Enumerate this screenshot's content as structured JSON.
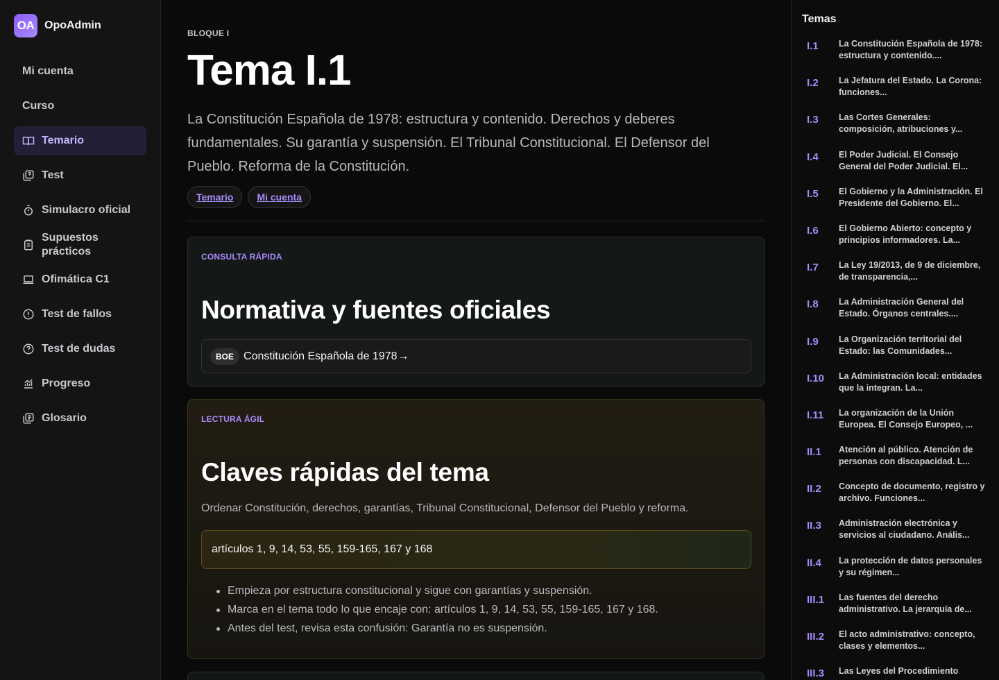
{
  "brand": {
    "logo": "OA",
    "name": "OpoAdmin"
  },
  "sidebar": {
    "items": [
      {
        "label": "Mi cuenta",
        "icon": "none",
        "active": false
      },
      {
        "label": "Curso",
        "icon": "none",
        "active": false
      },
      {
        "label": "Temario",
        "icon": "book-open-icon",
        "active": true
      },
      {
        "label": "Test",
        "icon": "quiz-icon",
        "active": false
      },
      {
        "label": "Simulacro oficial",
        "icon": "stopwatch-icon",
        "active": false
      },
      {
        "label": "Supuestos prácticos",
        "icon": "clipboard-icon",
        "active": false
      },
      {
        "label": "Ofimática C1",
        "icon": "laptop-icon",
        "active": false
      },
      {
        "label": "Test de fallos",
        "icon": "alert-circle-icon",
        "active": false
      },
      {
        "label": "Test de dudas",
        "icon": "help-circle-icon",
        "active": false
      },
      {
        "label": "Progreso",
        "icon": "chart-icon",
        "active": false
      },
      {
        "label": "Glosario",
        "icon": "library-icon",
        "active": false
      }
    ]
  },
  "main": {
    "block": "BLOQUE I",
    "title": "Tema I.1",
    "subtitle": "La Constitución Española de 1978: estructura y contenido. Derechos y deberes fundamentales. Su garantía y suspensión. El Tribunal Constitucional. El Defensor del Pueblo. Reforma de la Constitución.",
    "chips": [
      "Temario",
      "Mi cuenta"
    ],
    "quick_ref": {
      "eyebrow": "CONSULTA RÁPIDA",
      "title": "Normativa y fuentes oficiales",
      "source_badge": "BOE",
      "source_text": "Constitución Española de 1978",
      "source_arrow": "→"
    },
    "quick_read": {
      "eyebrow": "LECTURA ÁGIL",
      "title": "Claves rápidas del tema",
      "description": "Ordenar Constitución, derechos, garantías, Tribunal Constitucional, Defensor del Pueblo y reforma.",
      "articles": "artículos 1, 9, 14, 53, 55, 159-165, 167 y 168",
      "bullets": [
        "Empieza por estructura constitucional y sigue con garantías y suspensión.",
        "Marca en el tema todo lo que encaje con: artículos 1, 9, 14, 53, 55, 159-165, 167 y 168.",
        "Antes del test, revisa esta confusión: Garantía no es suspensión."
      ]
    }
  },
  "toc": {
    "title": "Temas",
    "items": [
      {
        "num": "I.1",
        "text": "La Constitución Española de 1978: estructura y contenido...."
      },
      {
        "num": "I.2",
        "text": "La Jefatura del Estado. La Corona: funciones..."
      },
      {
        "num": "I.3",
        "text": "Las Cortes Generales: composición, atribuciones y..."
      },
      {
        "num": "I.4",
        "text": "El Poder Judicial. El Consejo General del Poder Judicial. El..."
      },
      {
        "num": "I.5",
        "text": "El Gobierno y la Administración. El Presidente del Gobierno. El..."
      },
      {
        "num": "I.6",
        "text": "El Gobierno Abierto: concepto y principios informadores. La..."
      },
      {
        "num": "I.7",
        "text": "La Ley 19/2013, de 9 de diciembre, de transparencia,..."
      },
      {
        "num": "I.8",
        "text": "La Administración General del Estado. Órganos centrales...."
      },
      {
        "num": "I.9",
        "text": "La Organización territorial del Estado: las Comunidades..."
      },
      {
        "num": "I.10",
        "text": "La Administración local: entidades que la integran. La..."
      },
      {
        "num": "I.11",
        "text": "La organización de la Unión Europea. El Consejo Europeo, ..."
      },
      {
        "num": "II.1",
        "text": "Atención al público. Atención de personas con discapacidad. L..."
      },
      {
        "num": "II.2",
        "text": "Concepto de documento, registro y archivo. Funciones..."
      },
      {
        "num": "II.3",
        "text": "Administración electrónica y servicios al ciudadano. Anális..."
      },
      {
        "num": "II.4",
        "text": "La protección de datos personales y su régimen..."
      },
      {
        "num": "III.1",
        "text": "Las fuentes del derecho administrativo. La jerarquía de..."
      },
      {
        "num": "III.2",
        "text": "El acto administrativo: concepto, clases y elementos..."
      },
      {
        "num": "III.3",
        "text": "Las Leyes del Procedimiento"
      }
    ]
  },
  "colors": {
    "accent": "#a78bfa",
    "active_bg": "#231f36"
  }
}
